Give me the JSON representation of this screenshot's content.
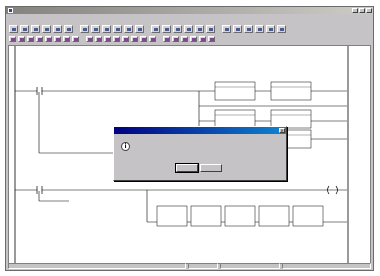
{
  "window": {
    "title": "",
    "app_icon": "plc-app-icon"
  },
  "menu": {
    "items": [
      "",
      "",
      "",
      "",
      "",
      "",
      "",
      "",
      ""
    ]
  },
  "toolbar_main": {
    "buttons": 24
  },
  "toolbar_secondary": {
    "buttons": 22
  },
  "diagram": {
    "rung_numbers": [
      "",
      ""
    ],
    "colors": {
      "rung_number": "#c0392b",
      "wire": "#000000",
      "canvas": "#ffffff"
    }
  },
  "dialog": {
    "title": "",
    "icon": "information-icon",
    "message": "",
    "buttons": [
      "",
      ""
    ]
  },
  "status": {
    "cells": [
      "",
      "",
      "",
      ""
    ]
  }
}
